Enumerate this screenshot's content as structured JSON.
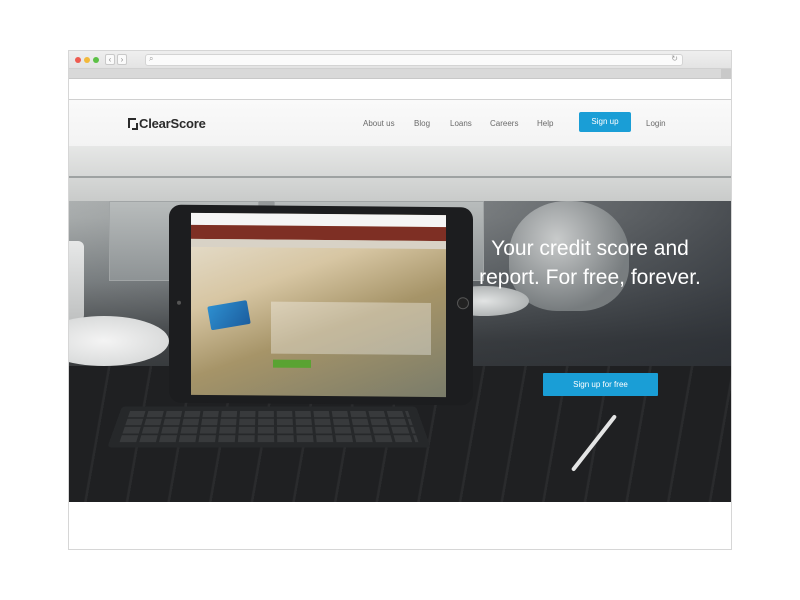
{
  "brand": {
    "name": "ClearScore",
    "accent_color": "#1a9ed6"
  },
  "browser": {
    "back_icon": "chevron-left-icon",
    "forward_icon": "chevron-right-icon",
    "search_icon": "search-icon",
    "reload_icon": "reload-icon"
  },
  "nav": {
    "items": [
      {
        "label": "About us"
      },
      {
        "label": "Blog"
      },
      {
        "label": "Loans"
      },
      {
        "label": "Careers"
      },
      {
        "label": "Help"
      }
    ],
    "signup_label": "Sign up",
    "login_label": "Login"
  },
  "hero": {
    "title_line1": "Your credit score and",
    "title_line2": "report. For free, forever.",
    "cta_label": "Sign up for free"
  }
}
